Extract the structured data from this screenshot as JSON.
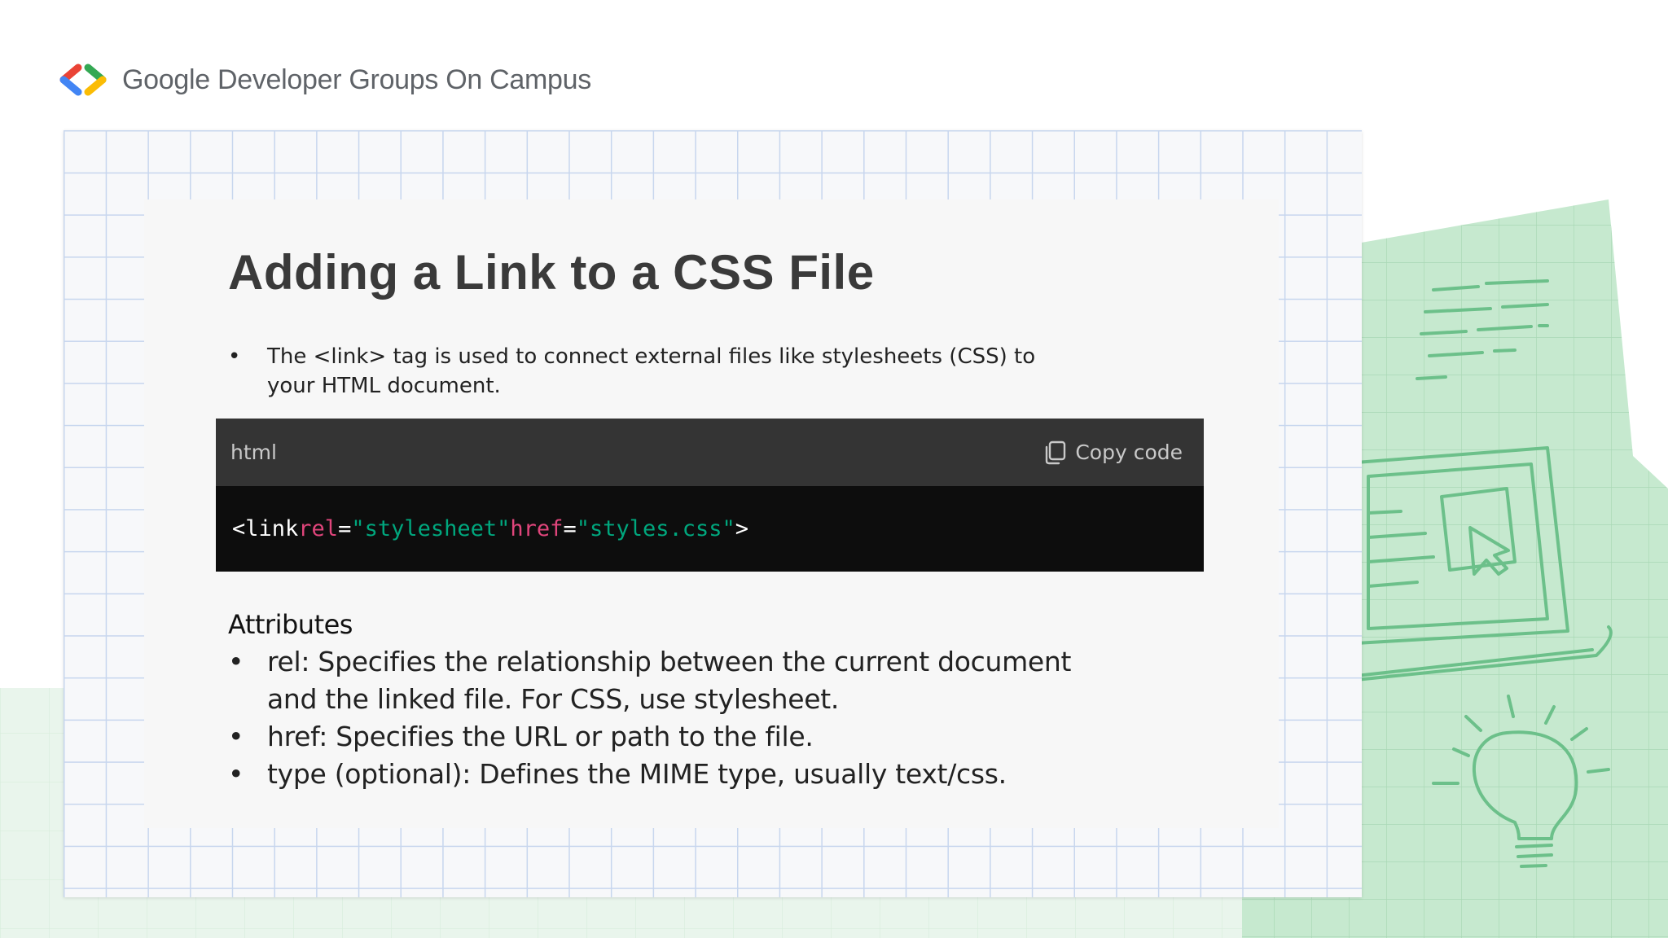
{
  "brand": {
    "name": "Google Developer Groups On Campus",
    "colors": {
      "red": "#ea4335",
      "blue": "#4285f4",
      "green": "#34a853",
      "yellow": "#fbbc04"
    }
  },
  "slide": {
    "title": "Adding a Link to a CSS File",
    "intro_bullet": "The <link> tag is used to connect external files like stylesheets (CSS) to your HTML document.",
    "code_block": {
      "language": "html",
      "copy_label": "Copy code",
      "tokens": {
        "tag_open": "<link",
        "attr1": "rel",
        "eq1": "=",
        "val1": "\"stylesheet\"",
        "attr2": "href",
        "eq2": "=",
        "val2": "\"styles.css\"",
        "tag_close": ">"
      }
    },
    "attributes_heading": "Attributes",
    "attributes": [
      "rel: Specifies the relationship between the current document and the linked file. For CSS, use stylesheet.",
      "href: Specifies the URL or path to the file.",
      "type (optional): Defines the MIME type, usually text/css."
    ],
    "bullet_symbol": "•"
  },
  "icons": {
    "logo": "gdg-chevrons-logo",
    "copy": "copy-icon",
    "decoration": [
      "laptop-cursor-sketch",
      "lightbulb-sketch"
    ]
  },
  "theme": {
    "accent_green": "#34a853",
    "sketch_green": "#6cc08a",
    "code_header_bg": "#343434",
    "code_body_bg": "#0d0d0d",
    "code_attr_color": "#e0457b",
    "code_string_color": "#00a67d"
  }
}
